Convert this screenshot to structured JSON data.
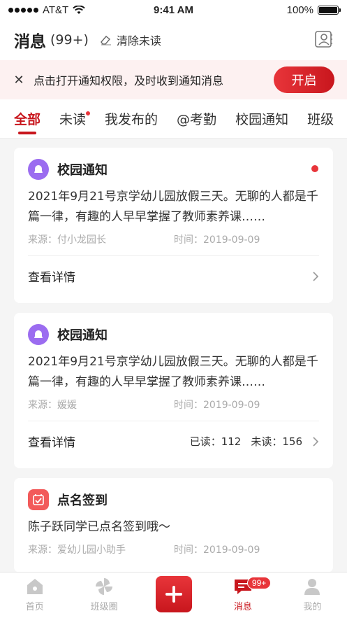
{
  "status_bar": {
    "carrier": "AT&T",
    "time": "9:41 AM",
    "battery": "100%"
  },
  "header": {
    "title": "消息",
    "count": "(99+)",
    "clear_label": "清除未读"
  },
  "banner": {
    "text": "点击打开通知权限，及时收到通知消息",
    "button": "开启"
  },
  "tabs": [
    {
      "label": "全部",
      "active": true
    },
    {
      "label": "未读",
      "dot": true
    },
    {
      "label": "我发布的"
    },
    {
      "label": "@考勤"
    },
    {
      "label": "校园通知"
    },
    {
      "label": "班级"
    }
  ],
  "cards": [
    {
      "title": "校园通知",
      "body": "2021年9月21号京学幼儿园放假三天。无聊的人都是千篇一律，有趣的人早早掌握了教师素养课……",
      "source": "来源：付小龙园长",
      "time": "时间：2019-09-09",
      "detail": "查看详情"
    },
    {
      "title": "校园通知",
      "body": "2021年9月21号京学幼儿园放假三天。无聊的人都是千篇一律，有趣的人早早掌握了教师素养课……",
      "source": "来源：媛媛",
      "time": "时间：2019-09-09",
      "detail": "查看详情",
      "read": "已读：112",
      "unread": "未读：156"
    },
    {
      "title": "点名签到",
      "body": "陈子跃同学已点名签到哦～",
      "source": "来源：爱幼儿园小助手",
      "time": "时间：2019-09-09"
    }
  ],
  "tabbar": {
    "home": "首页",
    "class_circle": "班级圈",
    "messages": "消息",
    "messages_badge": "99+",
    "mine": "我的"
  },
  "colors": {
    "accent": "#c8161d",
    "notice_icon": "#9b6cf0",
    "checkin_icon": "#f25a5a"
  }
}
